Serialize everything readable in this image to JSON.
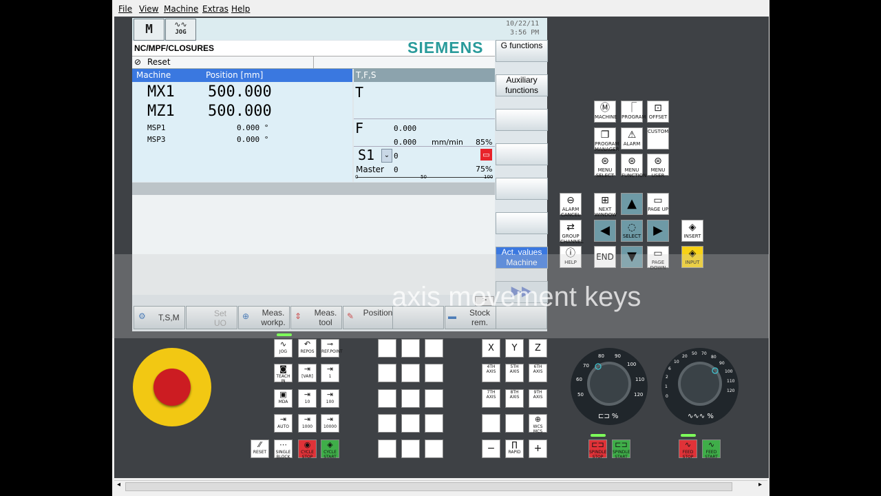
{
  "menu": [
    "File",
    "View",
    "Machine",
    "Extras",
    "Help"
  ],
  "header": {
    "mode_icon": "M",
    "mode_label": "JOG",
    "date": "10/22/11",
    "time": "3:56 PM",
    "path": "NC/MPF/CLOSURES",
    "brand": "SIEMENS",
    "status": "Reset"
  },
  "axes_table": {
    "col_machine": "Machine",
    "col_position": "Position [mm]",
    "rows": [
      {
        "name": "MX1",
        "value": "500.000"
      },
      {
        "name": "MZ1",
        "value": "500.000"
      },
      {
        "name": "MSP1",
        "value": "0.000 °"
      },
      {
        "name": "MSP3",
        "value": "0.000 °"
      }
    ]
  },
  "tfs": {
    "title": "T,F,S",
    "t_label": "T",
    "f_label": "F",
    "f_value1": "0.000",
    "f_value2": "0.000",
    "f_unit": "mm/min",
    "f_percent": "85%",
    "s_label": "S1",
    "s_value": "0",
    "master_label": "Master",
    "master_value": "0",
    "s_percent": "75%",
    "scale": [
      "0",
      "50",
      "100"
    ]
  },
  "vertical_softkeys": [
    "G functions",
    "Auxiliary functions",
    "",
    "",
    "",
    "",
    "Act. values Machine"
  ],
  "horizontal_softkeys": [
    "T,S,M",
    "Set UO",
    "Meas. workp.",
    "Meas. tool",
    "Position",
    "",
    "Stock rem.",
    ""
  ],
  "caption": "axis movement keys",
  "right_keys": {
    "machine": "MACHINE",
    "program": "PROGRAM",
    "offset": "OFFSET",
    "prog_manager": "PROGRAM MANAGER",
    "alarm": "ALARM",
    "custom": "CUSTOM",
    "menu_select": "MENU SELECT",
    "menu_function": "MENU FUNCTION",
    "menu_user": "MENU USER",
    "alarm_cancel": "ALARM CANCEL",
    "next_window": "NEXT WINDOW",
    "page_up": "PAGE UP",
    "group_channel": "GROUP CHANNEL",
    "select": "SELECT",
    "insert": "INSERT",
    "help": "HELP",
    "end": "END",
    "page_down": "PAGE DOWN",
    "input": "INPUT"
  },
  "mcp_keys": {
    "jog": "JOG",
    "repos": "REPOS",
    "ref_point": "REF.POINT",
    "teach_in": "TEACH IN",
    "var": "[VAR]",
    "inc1": "1",
    "mdi": "MDA",
    "inc10": "10",
    "inc100": "100",
    "auto": "AUTO",
    "inc1000": "1000",
    "inc10000": "10000",
    "reset": "RESET",
    "single_block": "SINGLE BLOCK",
    "cycle_stop": "CYCLE STOP",
    "cycle_start": "CYCLE START",
    "x": "X",
    "y": "Y",
    "z": "Z",
    "ax4": "4TH AXIS",
    "ax5": "5TH AXIS",
    "ax6": "6TH AXIS",
    "ax7": "7TH AXIS",
    "ax8": "8TH AXIS",
    "ax9": "9TH AXIS",
    "wcs": "WCS MCS",
    "minus": "−",
    "rapid": "RAPID",
    "plus": "+",
    "spindle_stop": "SPINDLE STOP",
    "spindle_start": "SPINDLE START",
    "feed_stop": "FEED STOP",
    "feed_start": "FEED START"
  },
  "dial_left": {
    "ticks": [
      "50",
      "60",
      "70",
      "80",
      "90",
      "100",
      "110",
      "120"
    ],
    "label": "%"
  },
  "dial_right": {
    "ticks": [
      "0",
      "10",
      "20",
      "30",
      "40",
      "50",
      "60",
      "70",
      "80",
      "90",
      "100",
      "110",
      "120"
    ],
    "label": "%"
  },
  "colors": {
    "accent": "#3a78e0",
    "brand": "#2a9b9b",
    "nav": "#6e9aa6",
    "input": "#f7d116",
    "estop": "#f2c813"
  }
}
